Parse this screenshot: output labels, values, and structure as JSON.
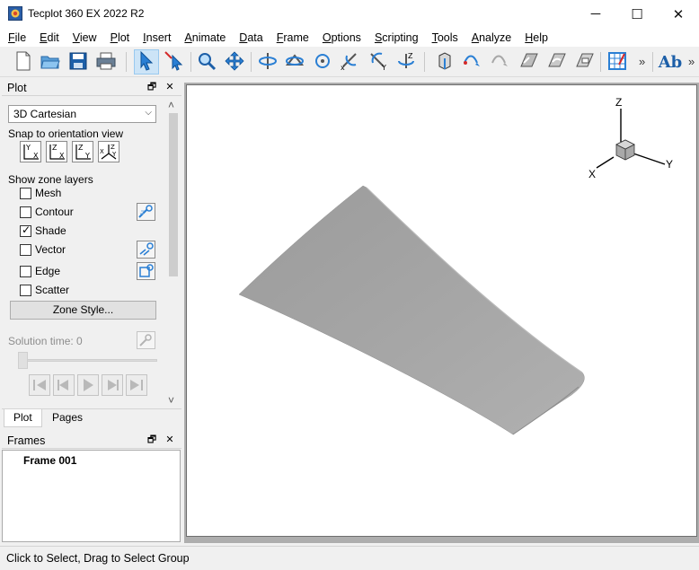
{
  "window": {
    "title": "Tecplot 360 EX 2022 R2",
    "minimize": "─",
    "maximize": "☐",
    "close": "✕"
  },
  "menu": [
    {
      "underline": "F",
      "rest": "ile"
    },
    {
      "underline": "E",
      "rest": "dit"
    },
    {
      "underline": "V",
      "rest": "iew"
    },
    {
      "underline": "P",
      "rest": "lot"
    },
    {
      "underline": "I",
      "rest": "nsert"
    },
    {
      "underline": "A",
      "rest": "nimate"
    },
    {
      "underline": "D",
      "rest": "ata"
    },
    {
      "underline": "F",
      "rest": "rame"
    },
    {
      "underline": "O",
      "rest": "ptions"
    },
    {
      "underline": "S",
      "rest": "cripting"
    },
    {
      "underline": "T",
      "rest": "ools"
    },
    {
      "underline": "A",
      "rest": "nalyze"
    },
    {
      "underline": "H",
      "rest": "elp"
    }
  ],
  "toolbar": {
    "more": "»",
    "text_tool": "Ab"
  },
  "plot_panel": {
    "title": "Plot",
    "restore": "🗗",
    "close": "✕",
    "plot_type": "3D Cartesian",
    "dropdown_arrow": "⌵",
    "snap_label": "Snap to orientation view",
    "layers_label": "Show zone layers",
    "layers": [
      {
        "label": "Mesh",
        "checked": false
      },
      {
        "label": "Contour",
        "checked": false
      },
      {
        "label": "Shade",
        "checked": true
      },
      {
        "label": "Vector",
        "checked": false
      },
      {
        "label": "Edge",
        "checked": false
      },
      {
        "label": "Scatter",
        "checked": false
      }
    ],
    "check_mark": "✓",
    "zone_style_button": "Zone Style...",
    "solution_time_label": "Solution time: 0",
    "scroll_up": "˄",
    "scroll_down": "˅"
  },
  "tabs": {
    "plot": "Plot",
    "pages": "Pages"
  },
  "frames_panel": {
    "title": "Frames",
    "restore": "🗗",
    "close": "✕",
    "frame_name": "Frame 001"
  },
  "axis_triad": {
    "x": "X",
    "y": "Y",
    "z": "Z"
  },
  "colors": {
    "wing_fill": "#a3a3a3",
    "accent": "#0078d7",
    "canvas_bg": "#ffffff",
    "workspace_bg": "#aeaeae"
  },
  "statusbar": {
    "text": "Click to Select, Drag to Select Group"
  }
}
